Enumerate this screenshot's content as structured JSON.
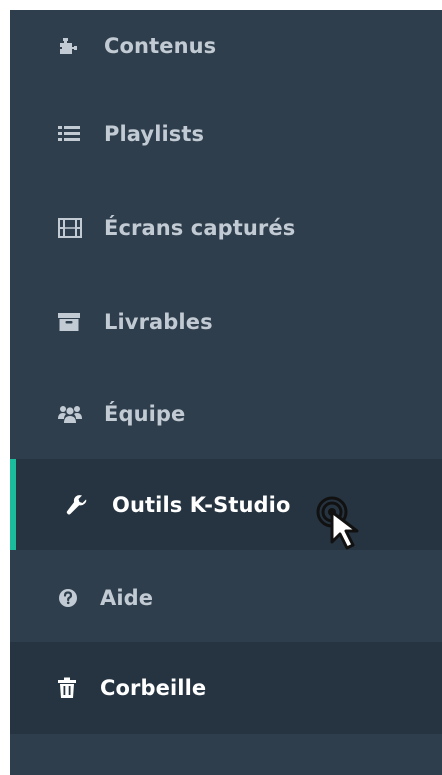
{
  "colors": {
    "sidebar_bg": "#2f3e4c",
    "active_bg": "#263441",
    "accent": "#1abc9c",
    "text": "#c2cbd4",
    "active_text": "#ffffff"
  },
  "menu": {
    "items": [
      {
        "label": "Contenus",
        "icon": "puzzle-icon"
      },
      {
        "label": "Playlists",
        "icon": "list-icon"
      },
      {
        "label": "Écrans capturés",
        "icon": "film-icon"
      },
      {
        "label": "Livrables",
        "icon": "archive-icon"
      },
      {
        "label": "Équipe",
        "icon": "users-icon"
      },
      {
        "label": "Outils K-Studio",
        "icon": "wrench-icon",
        "active": true
      },
      {
        "label": "Aide",
        "icon": "question-circle-icon"
      },
      {
        "label": "Corbeille",
        "icon": "trash-icon"
      }
    ]
  }
}
